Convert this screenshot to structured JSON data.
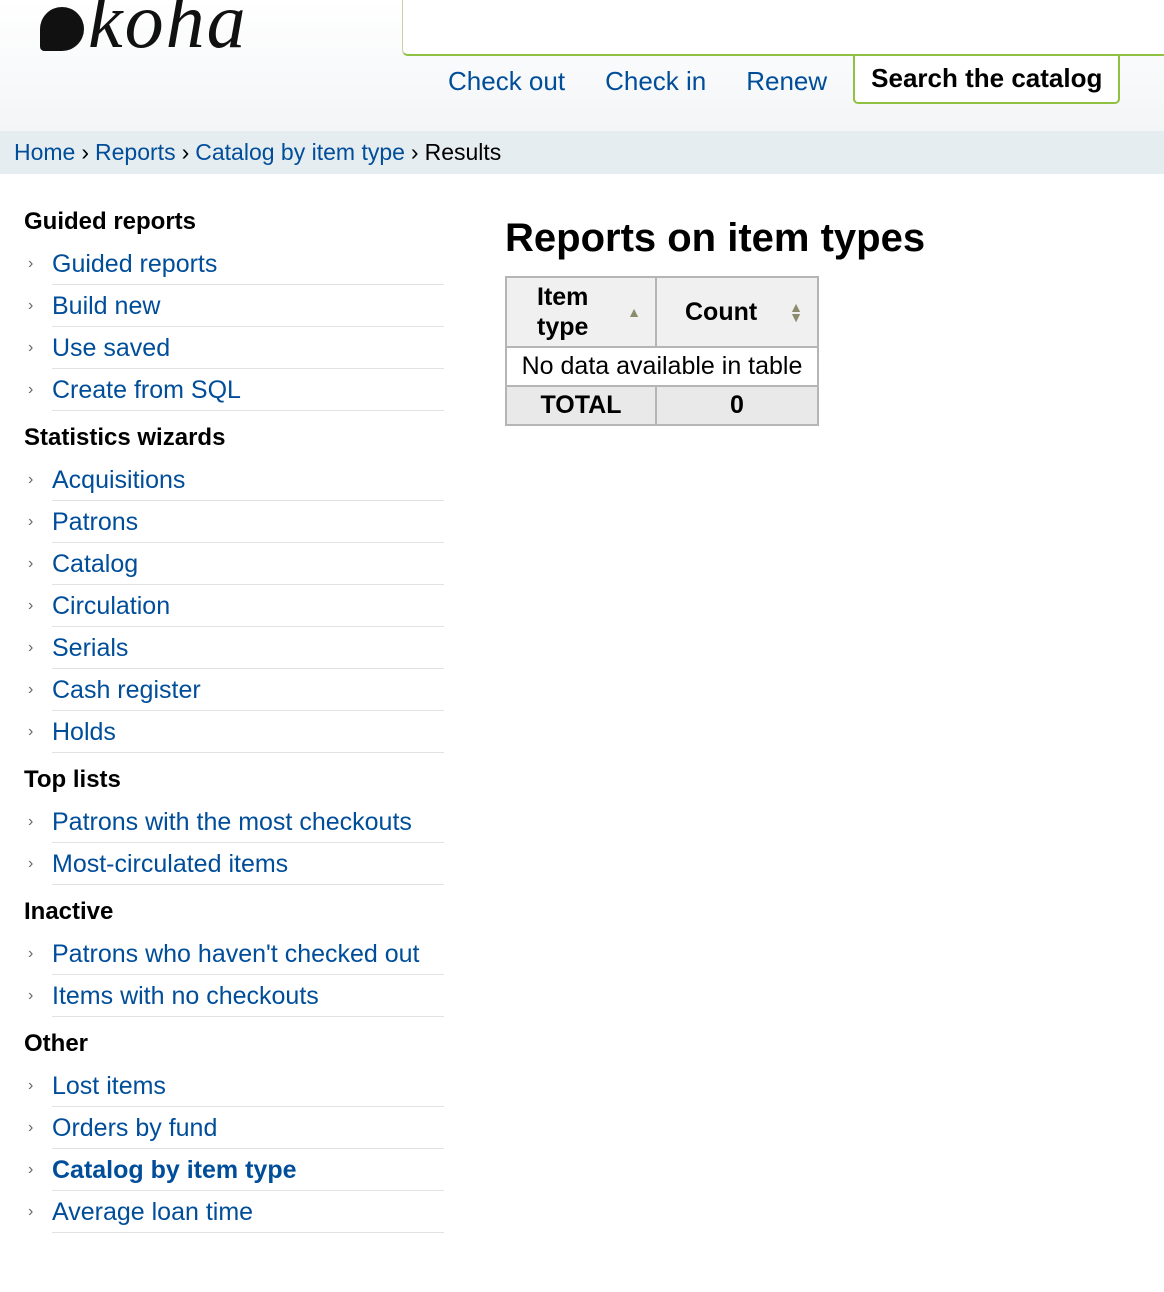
{
  "header": {
    "logo_text": "koha",
    "tabs": [
      {
        "label": "Check out"
      },
      {
        "label": "Check in"
      },
      {
        "label": "Renew"
      },
      {
        "label": "Search the catalog"
      }
    ]
  },
  "breadcrumb": {
    "items": [
      "Home",
      "Reports",
      "Catalog by item type"
    ],
    "current": "Results",
    "separator": "›"
  },
  "sidebar": {
    "sections": [
      {
        "title": "Guided reports",
        "items": [
          "Guided reports",
          "Build new",
          "Use saved",
          "Create from SQL"
        ]
      },
      {
        "title": "Statistics wizards",
        "items": [
          "Acquisitions",
          "Patrons",
          "Catalog",
          "Circulation",
          "Serials",
          "Cash register",
          "Holds"
        ]
      },
      {
        "title": "Top lists",
        "items": [
          "Patrons with the most checkouts",
          "Most-circulated items"
        ]
      },
      {
        "title": "Inactive",
        "items": [
          "Patrons who haven't checked out",
          "Items with no checkouts"
        ]
      },
      {
        "title": "Other",
        "items": [
          "Lost items",
          "Orders by fund",
          "Catalog by item type",
          "Average loan time"
        ]
      }
    ]
  },
  "main": {
    "title": "Reports on item types",
    "table": {
      "headers": [
        "Item type",
        "Count"
      ],
      "empty_message": "No data available in table",
      "total_label": "TOTAL",
      "total_value": "0"
    }
  },
  "colors": {
    "link": "#004d99",
    "accent_green": "#8fc143",
    "breadcrumb_bg": "#e6edf0"
  },
  "icons": {
    "sort_asc": "sort-ascending-icon",
    "sort_both": "sort-both-icon",
    "nav_chevron": "chevron-right-icon"
  }
}
